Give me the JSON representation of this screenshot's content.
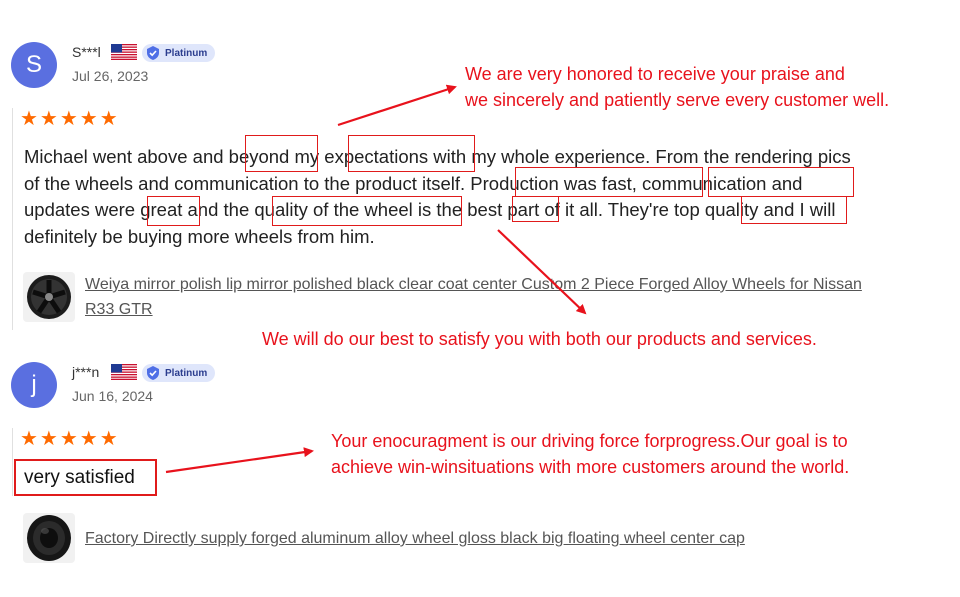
{
  "reviews": [
    {
      "avatar_letter": "S",
      "username": "S***l",
      "badge": "Platinum",
      "date": "Jul 26, 2023",
      "stars": "★★★★★",
      "text_lines": [
        "Michael went above and beyond my expectations with my whole experience. From the rendering pics",
        "of the wheels and communication to the product itself. Production was fast, communication and",
        "updates were great and the quality of the wheel is the best part of it all. They're top quality and I will",
        "definitely be buying more wheels from him."
      ],
      "product_line1": "Weiya mirror polish lip mirror polished black clear coat center Custom 2 Piece Forged Alloy Wheels for Nissan",
      "product_line2": "R33 GTR",
      "product_image": "black-5-spoke-wheel-image"
    },
    {
      "avatar_letter": "j",
      "username": "j***n",
      "badge": "Platinum",
      "date": "Jun 16, 2024",
      "stars": "★★★★★",
      "text": "very satisfied",
      "product": "Factory Directly supply forged aluminum alloy wheel gloss black big floating wheel center cap",
      "product_image": "black-wheel-center-cap-image"
    }
  ],
  "annotations": {
    "note1_line1": "We are very honored to receive your praise and",
    "note1_line2": "we sincerely and patiently serve every customer well.",
    "note2": "We will do our best to satisfy you with both our products and services.",
    "note3_line1": "Your enocuragment is our driving force forprogress.Our goal is to",
    "note3_line2": "achieve win-winsituations with more customers around the world."
  },
  "colors": {
    "accent_red": "#e8121c",
    "star_orange": "#ff6a00",
    "avatar_blue": "#5a6fe0",
    "badge_bg": "#dfe6fb"
  }
}
